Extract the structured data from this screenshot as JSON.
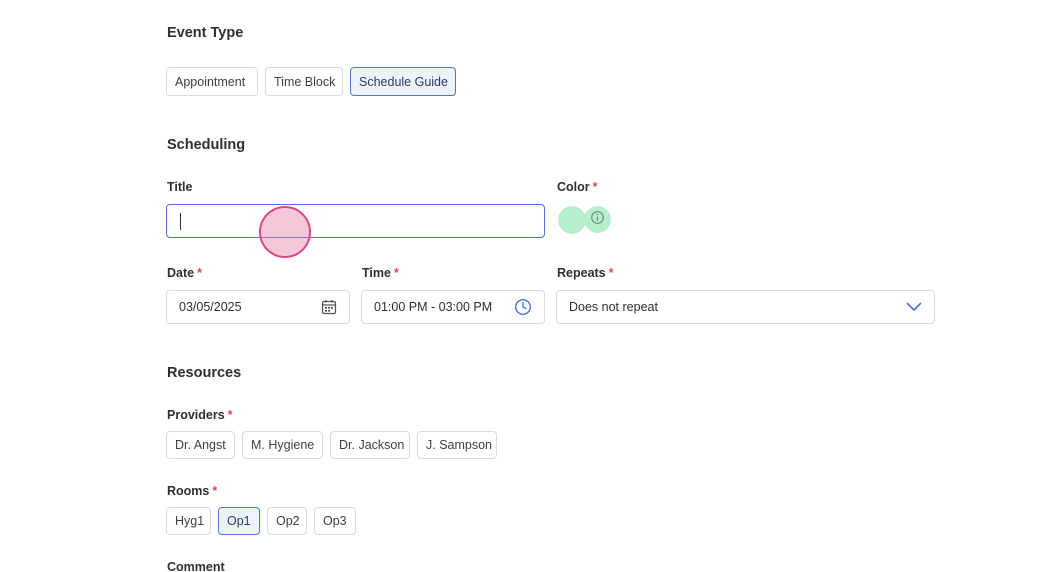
{
  "event_type": {
    "heading": "Event Type",
    "options": [
      "Appointment",
      "Time Block",
      "Schedule Guide"
    ],
    "selected": "Schedule Guide"
  },
  "scheduling": {
    "heading": "Scheduling",
    "title": {
      "label": "Title",
      "value": ""
    },
    "color": {
      "label": "Color",
      "required_mark": "*",
      "swatch_color": "#b5efcb"
    },
    "date": {
      "label": "Date",
      "required_mark": "*",
      "value": "03/05/2025",
      "icon": "calendar-icon"
    },
    "time": {
      "label": "Time",
      "required_mark": "*",
      "value": "01:00 PM - 03:00 PM",
      "icon": "clock-icon"
    },
    "repeats": {
      "label": "Repeats",
      "required_mark": "*",
      "value": "Does not repeat",
      "icon": "chevron-down-icon"
    }
  },
  "resources": {
    "heading": "Resources",
    "providers": {
      "label": "Providers",
      "required_mark": "*",
      "options": [
        "Dr. Angst",
        "M. Hygiene",
        "Dr. Jackson",
        "J. Sampson"
      ]
    },
    "rooms": {
      "label": "Rooms",
      "required_mark": "*",
      "options": [
        "Hyg1",
        "Op1",
        "Op2",
        "Op3"
      ],
      "selected": "Op1"
    }
  },
  "comment": {
    "label": "Comment"
  },
  "colors": {
    "accent": "#4a78d8",
    "required": "#e0454a",
    "swatch": "#b5efcb",
    "touch_indicator": "#d9478a"
  }
}
